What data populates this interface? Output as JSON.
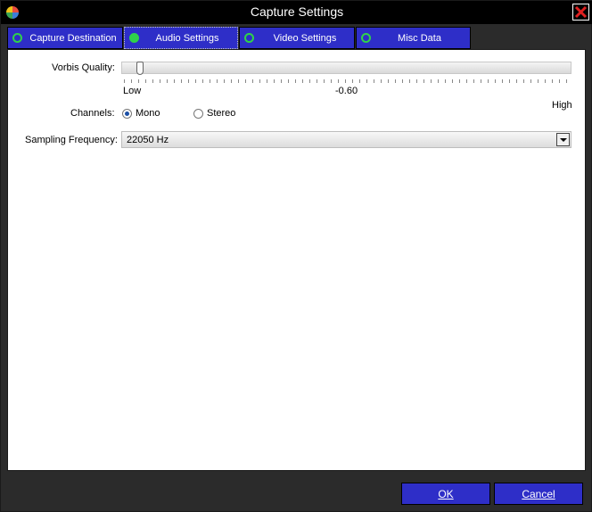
{
  "window": {
    "title": "Capture Settings"
  },
  "tabs": [
    {
      "label": "Capture Destination"
    },
    {
      "label": "Audio Settings"
    },
    {
      "label": "Video Settings"
    },
    {
      "label": "Misc Data"
    }
  ],
  "active_tab": "Audio Settings",
  "audio": {
    "vorbis_quality_label": "Vorbis Quality:",
    "slider_low": "Low",
    "slider_value": "-0.60",
    "slider_high": "High",
    "channels_label": "Channels:",
    "channel_options": [
      {
        "label": "Mono",
        "checked": true
      },
      {
        "label": "Stereo",
        "checked": false
      }
    ],
    "sampling_label": "Sampling Frequency:",
    "sampling_value": "22050 Hz"
  },
  "buttons": {
    "ok": "OK",
    "cancel": "Cancel"
  },
  "colors": {
    "tab_blue": "#2e2ec8",
    "tab_indicator_green": "#2fd24a",
    "titlebar": "#000000"
  }
}
